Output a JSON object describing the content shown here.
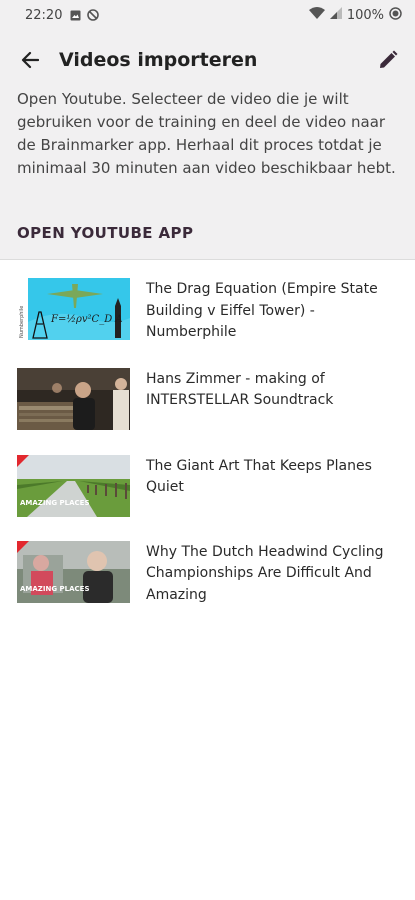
{
  "status_bar": {
    "time": "22:20",
    "battery": "100%"
  },
  "app_bar": {
    "title": "Videos importeren"
  },
  "header": {
    "description": "Open Youtube. Selecteer de video die je wilt gebruiken voor de training en deel de video naar de Brainmarker app. Herhaal dit proces totdat je minimaal 30 minuten aan video beschikbaar hebt.",
    "open_button": "OPEN YOUTUBE APP"
  },
  "videos": [
    {
      "title": "The Drag Equation (Empire State Building v Eiffel Tower) - Numberphile",
      "thumb_text": "F=½ρv²C_D A",
      "thumb_side": "Numberphile"
    },
    {
      "title": "Hans Zimmer - making of INTERSTELLAR Soundtrack"
    },
    {
      "title": "The Giant Art That Keeps Planes Quiet",
      "thumb_text": "AMAZING PLACES"
    },
    {
      "title": "Why The Dutch Headwind Cycling Championships Are Difficult And Amazing",
      "thumb_text": "AMAZING PLACES"
    }
  ],
  "colors": {
    "header_bg": "#f1f0f1",
    "accent": "#3b2a3a"
  }
}
